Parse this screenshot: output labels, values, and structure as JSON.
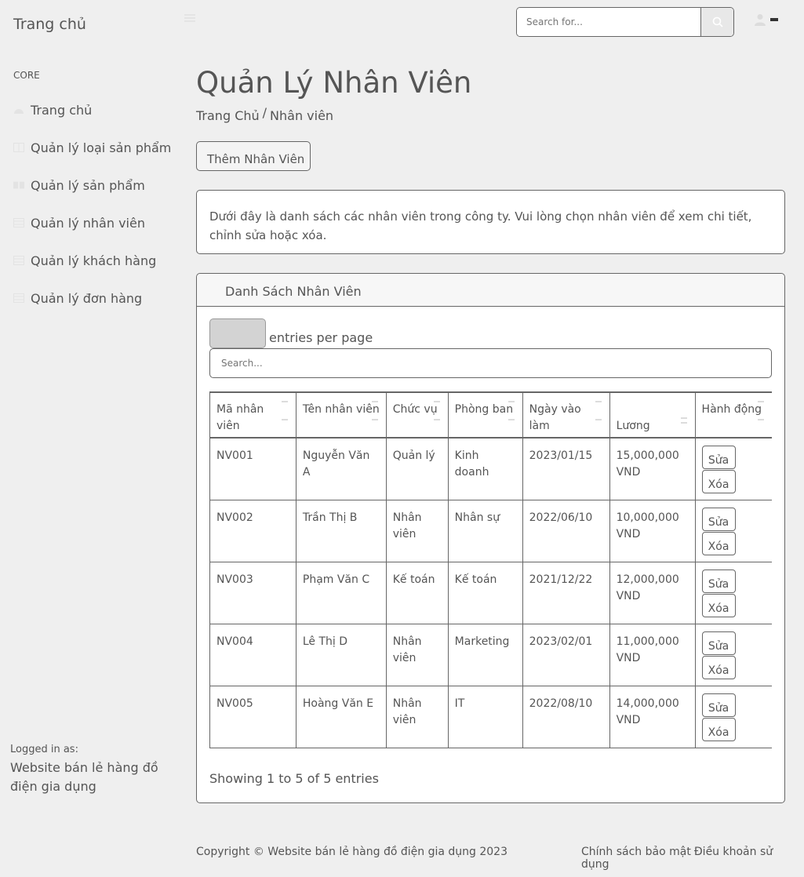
{
  "navbar": {
    "brand": "Trang chủ",
    "search_placeholder": "Search for..."
  },
  "sidebar": {
    "heading": "CORE",
    "items": [
      {
        "label": "Trang chủ",
        "icon": "tachometer-icon"
      },
      {
        "label": "Quản lý loại sản phẩm",
        "icon": "columns-icon"
      },
      {
        "label": "Quản lý sản phẩm",
        "icon": "book-open-icon"
      },
      {
        "label": "Quản lý nhân viên",
        "icon": "table-icon"
      },
      {
        "label": "Quản lý khách hàng",
        "icon": "table-icon"
      },
      {
        "label": "Quản lý đơn hàng",
        "icon": "table-icon"
      }
    ],
    "logged_label": "Logged in as:",
    "logged_user": "Website bán lẻ hàng đồ điện gia dụng"
  },
  "main": {
    "title": "Quản Lý Nhân Viên",
    "breadcrumb": {
      "home": "Trang Chủ",
      "separator": "/",
      "current": "Nhân viên"
    },
    "add_button": "Thêm Nhân Viên",
    "info_text": "Dưới đây là danh sách các nhân viên trong công ty. Vui lòng chọn nhân viên để xem chi tiết, chỉnh sửa hoặc xóa.",
    "card_title": "Danh Sách Nhân Viên",
    "entries_text": "entries per page",
    "search_placeholder": "Search...",
    "columns": [
      "Mã nhân viên",
      "Tên nhân viên",
      "Chức vụ",
      "Phòng ban",
      "Ngày vào làm",
      "Lương",
      "Hành động"
    ],
    "rows": [
      {
        "id": "NV001",
        "name": "Nguyễn Văn A",
        "position": "Quản lý",
        "department": "Kinh doanh",
        "start_date": "2023/01/15",
        "salary": "15,000,000 VND"
      },
      {
        "id": "NV002",
        "name": "Trần Thị B",
        "position": "Nhân viên",
        "department": "Nhân sự",
        "start_date": "2022/06/10",
        "salary": "10,000,000 VND"
      },
      {
        "id": "NV003",
        "name": "Phạm Văn C",
        "position": "Kế toán",
        "department": "Kế toán",
        "start_date": "2021/12/22",
        "salary": "12,000,000 VND"
      },
      {
        "id": "NV004",
        "name": "Lê Thị D",
        "position": "Nhân viên",
        "department": "Marketing",
        "start_date": "2023/02/01",
        "salary": "11,000,000 VND"
      },
      {
        "id": "NV005",
        "name": "Hoàng Văn E",
        "position": "Nhân viên",
        "department": "IT",
        "start_date": "2022/08/10",
        "salary": "14,000,000 VND"
      }
    ],
    "edit_label": "Sửa",
    "delete_label": "Xóa",
    "showing_text": "Showing 1 to 5 of 5 entries"
  },
  "footer": {
    "copyright": "Copyright © Website bán lẻ hàng đồ điện gia dụng 2023",
    "privacy": "Chính sách bảo mật",
    "terms": "Điều khoản sử dụng"
  }
}
